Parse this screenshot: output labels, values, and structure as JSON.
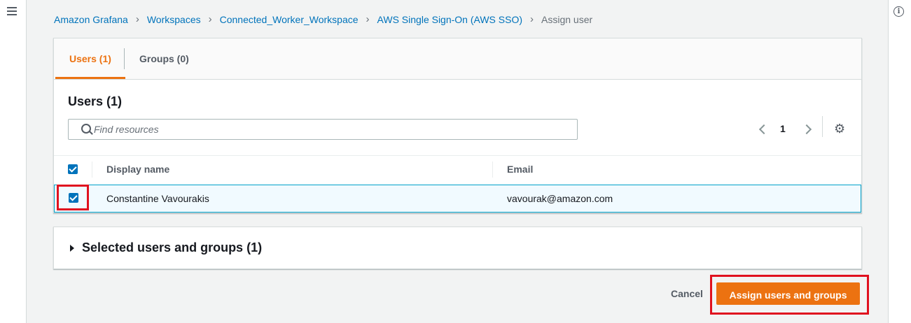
{
  "breadcrumb": {
    "items": [
      "Amazon Grafana",
      "Workspaces",
      "Connected_Worker_Workspace",
      "AWS Single Sign-On (AWS SSO)"
    ],
    "current": "Assign user"
  },
  "tabs": [
    {
      "label": "Users (1)",
      "active": true
    },
    {
      "label": "Groups (0)",
      "active": false
    }
  ],
  "users_panel": {
    "title": "Users (1)",
    "search_placeholder": "Find resources",
    "page": "1",
    "columns": [
      "Display name",
      "Email"
    ],
    "rows": [
      {
        "display_name": "Constantine Vavourakis",
        "email": "vavourak@amazon.com",
        "selected": true
      }
    ]
  },
  "selected_section": {
    "title": "Selected users and groups (1)"
  },
  "actions": {
    "cancel": "Cancel",
    "assign": "Assign users and groups"
  },
  "colors": {
    "accent": "#ec7211",
    "link": "#0073bb",
    "highlight": "#e0111f",
    "selected_row": "#f1faff"
  },
  "icons": [
    "menu-icon",
    "info-icon",
    "search-icon",
    "chevron-left-icon",
    "chevron-right-icon",
    "settings-gear-icon",
    "caret-right-icon",
    "checkbox-checked-icon"
  ]
}
